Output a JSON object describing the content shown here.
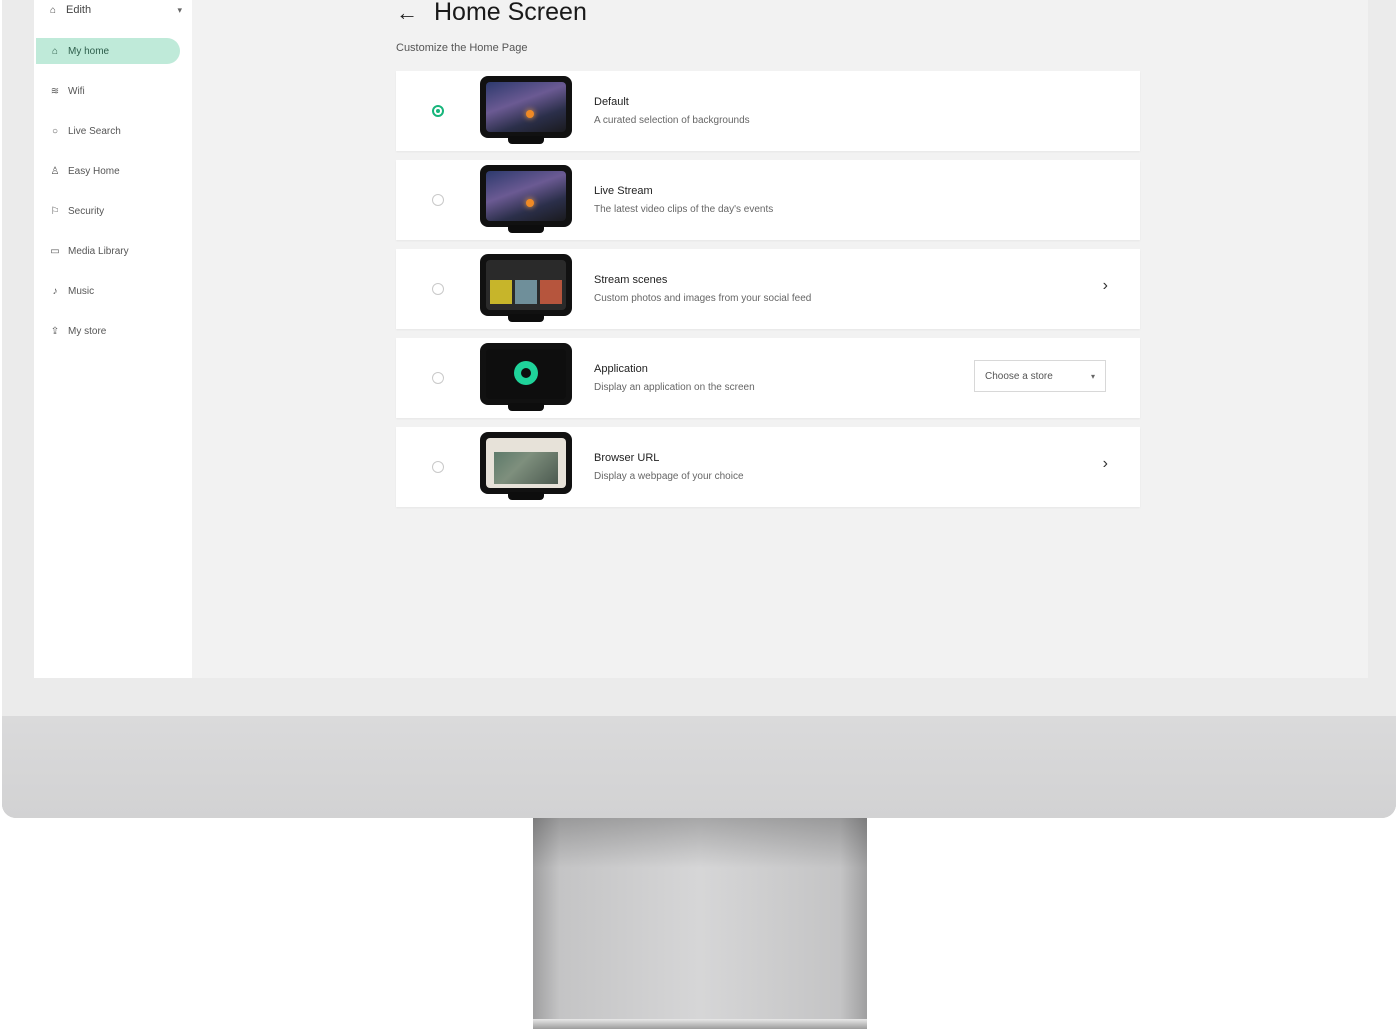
{
  "account": {
    "label": "Edith",
    "chevron": "▾",
    "icon": "home-icon"
  },
  "nav": {
    "items": [
      {
        "label": "My home",
        "icon": "⌂",
        "active": true
      },
      {
        "label": "Wifi",
        "icon": "≋",
        "active": false
      },
      {
        "label": "Live Search",
        "icon": "○",
        "active": false
      },
      {
        "label": "Easy Home",
        "icon": "♙",
        "active": false
      },
      {
        "label": "Security",
        "icon": "⚐",
        "active": false
      },
      {
        "label": "Media Library",
        "icon": "▭",
        "active": false
      },
      {
        "label": "Music",
        "icon": "♪",
        "active": false
      },
      {
        "label": "My store",
        "icon": "⇪",
        "active": false
      }
    ]
  },
  "header": {
    "back_icon": "←",
    "title": "Home Screen"
  },
  "subtitle": "Customize the Home Page",
  "options": [
    {
      "title": "Default",
      "description": "A curated selection of backgrounds",
      "checked": true
    },
    {
      "title": "Live Stream",
      "description": "The latest video clips of the day's events",
      "checked": false
    },
    {
      "title": "Stream scenes",
      "description": "Custom photos and images from your social feed",
      "checked": false,
      "chevron": "›"
    },
    {
      "title": "Application",
      "description": "Display an application on the screen",
      "checked": false,
      "select": {
        "value": "Choose a store",
        "caret": "▾"
      }
    },
    {
      "title": "Browser URL",
      "description": "Display a webpage of your choice",
      "checked": false,
      "chevron": "›"
    }
  ],
  "colors": {
    "accent": "#17b57b",
    "nav_active_bg": "#bfead9"
  }
}
